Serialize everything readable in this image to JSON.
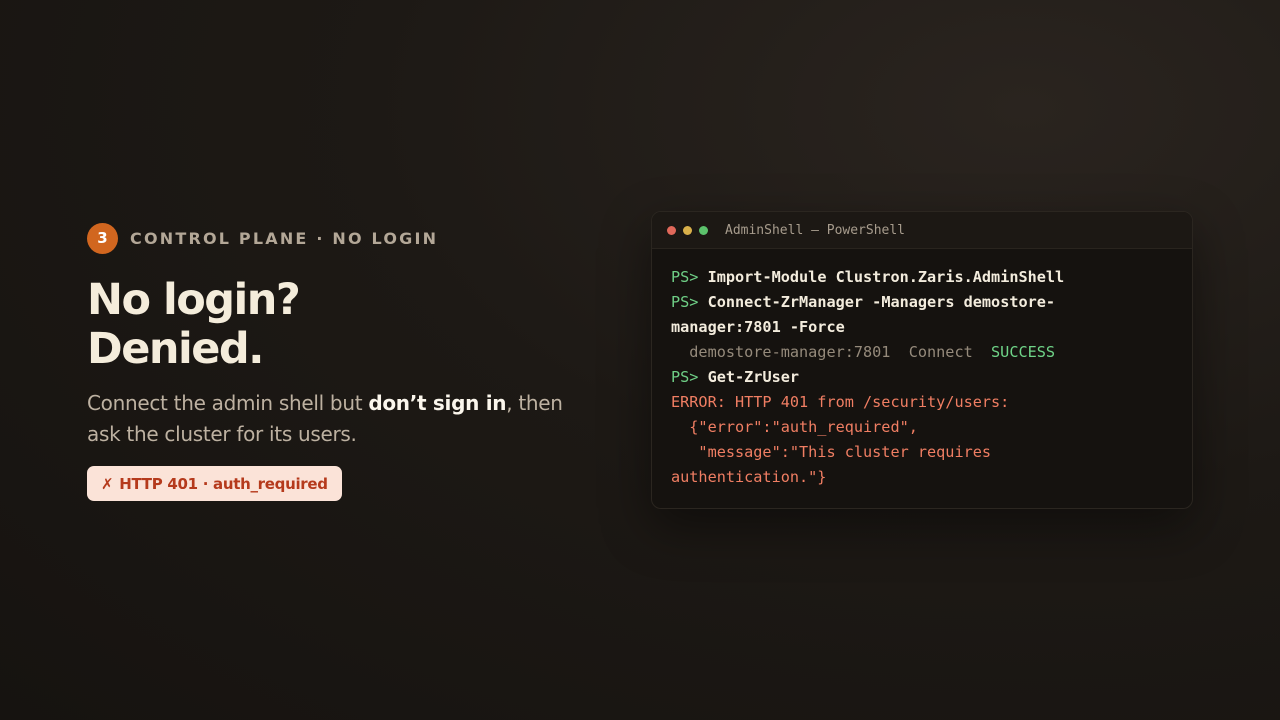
{
  "slide": {
    "step_number": "3",
    "eyebrow": "CONTROL PLANE · NO LOGIN",
    "headline_line1": "No login?",
    "headline_line2": "Denied.",
    "subtitle_part1": "Connect the admin shell but ",
    "subtitle_bold": "don’t sign in",
    "subtitle_part2": ", then",
    "subtitle_line2": "ask the cluster for its users.",
    "error_pill_icon": "✗",
    "error_pill_text": "HTTP 401 · auth_required"
  },
  "terminal": {
    "title": "AdminShell — PowerShell",
    "prompt": "PS>",
    "line1_cmd": "Import-Module Clustron.Zaris.AdminShell",
    "line2_cmd": "Connect-ZrManager -Managers demostore-",
    "line3_cont": "manager:7801 -Force",
    "line4_host": "  demostore-manager:7801  Connect  ",
    "line4_status": "SUCCESS",
    "line5_cmd": "Get-ZrUser",
    "line6_err": "ERROR: HTTP 401 from /security/users:",
    "line7_err": "  {\"error\":\"auth_required\",",
    "line8_err": "   \"message\":\"This cluster requires",
    "line9_err": "authentication.\"}"
  },
  "colors": {
    "accent": "#d1661f",
    "success": "#6fd488",
    "error": "#f07e63",
    "prompt": "#6fcf86"
  }
}
